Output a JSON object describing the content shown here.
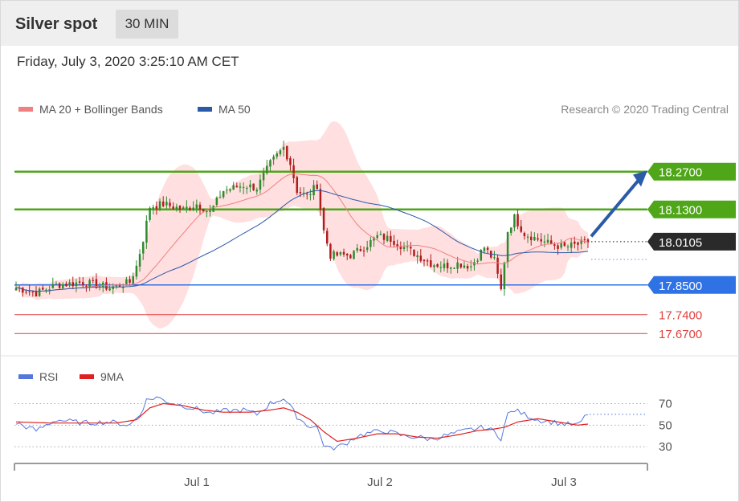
{
  "header": {
    "title": "Silver spot",
    "timeframe": "30 MIN"
  },
  "datetime": "Friday, July 3, 2020 3:25:10 AM CET",
  "legend_top": {
    "ma20": {
      "label": "MA 20 + Bollinger Bands",
      "color": "#f08080"
    },
    "ma50": {
      "label": "MA 50",
      "color": "#2b5aa8"
    }
  },
  "credit": "Research © 2020 Trading Central",
  "legend_rsi": {
    "rsi": {
      "label": "RSI",
      "color": "#5577dd"
    },
    "ma9": {
      "label": "9MA",
      "color": "#e02020"
    }
  },
  "chart_data": {
    "type": "candlestick",
    "price_range": [
      17.62,
      18.43
    ],
    "x_ticks": [
      "Jul 1",
      "Jul 2",
      "Jul 3"
    ],
    "levels": [
      {
        "value": "18.2700",
        "color": "#4ea618",
        "type": "resistance"
      },
      {
        "value": "18.1300",
        "color": "#4ea618",
        "type": "resistance"
      },
      {
        "value": "18.0105",
        "color": "#2a2a2a",
        "type": "last"
      },
      {
        "value": "17.8500",
        "color": "#2f72e6",
        "type": "pivot"
      },
      {
        "value": "17.7400",
        "color": "#e04040",
        "type": "support"
      },
      {
        "value": "17.6700",
        "color": "#e04040",
        "type": "support"
      }
    ],
    "close_keypoints": [
      [
        0,
        17.84
      ],
      [
        6,
        17.82
      ],
      [
        12,
        17.85
      ],
      [
        20,
        17.86
      ],
      [
        28,
        17.84
      ],
      [
        34,
        17.86
      ],
      [
        36,
        17.92
      ],
      [
        38,
        18.02
      ],
      [
        40,
        18.14
      ],
      [
        44,
        18.15
      ],
      [
        50,
        18.13
      ],
      [
        54,
        18.15
      ],
      [
        58,
        18.12
      ],
      [
        62,
        18.2
      ],
      [
        68,
        18.22
      ],
      [
        72,
        18.21
      ],
      [
        76,
        18.3
      ],
      [
        80,
        18.36
      ],
      [
        82,
        18.3
      ],
      [
        84,
        18.2
      ],
      [
        87,
        18.18
      ],
      [
        90,
        18.22
      ],
      [
        92,
        18.05
      ],
      [
        94,
        17.96
      ],
      [
        100,
        17.96
      ],
      [
        104,
        17.99
      ],
      [
        108,
        18.03
      ],
      [
        112,
        18.02
      ],
      [
        116,
        17.99
      ],
      [
        120,
        17.96
      ],
      [
        124,
        17.93
      ],
      [
        128,
        17.92
      ],
      [
        132,
        17.93
      ],
      [
        136,
        17.92
      ],
      [
        140,
        17.99
      ],
      [
        143,
        17.94
      ],
      [
        145,
        17.83
      ],
      [
        147,
        18.05
      ],
      [
        149,
        18.1
      ],
      [
        152,
        18.04
      ],
      [
        156,
        18.02
      ],
      [
        160,
        18.0
      ],
      [
        164,
        17.99
      ],
      [
        168,
        18.0
      ],
      [
        171,
        18.01
      ]
    ],
    "rsi": {
      "y_ticks": [
        70,
        50,
        30
      ],
      "range": [
        22,
        80
      ],
      "rsi_keypoints": [
        [
          0,
          52
        ],
        [
          6,
          45
        ],
        [
          12,
          55
        ],
        [
          20,
          52
        ],
        [
          28,
          53
        ],
        [
          34,
          50
        ],
        [
          37,
          60
        ],
        [
          39,
          73
        ],
        [
          42,
          76
        ],
        [
          45,
          72
        ],
        [
          50,
          68
        ],
        [
          54,
          65
        ],
        [
          58,
          61
        ],
        [
          62,
          63
        ],
        [
          68,
          64
        ],
        [
          72,
          60
        ],
        [
          76,
          70
        ],
        [
          80,
          75
        ],
        [
          82,
          67
        ],
        [
          84,
          58
        ],
        [
          87,
          50
        ],
        [
          90,
          48
        ],
        [
          92,
          32
        ],
        [
          94,
          28
        ],
        [
          98,
          32
        ],
        [
          102,
          40
        ],
        [
          106,
          43
        ],
        [
          110,
          45
        ],
        [
          116,
          40
        ],
        [
          120,
          39
        ],
        [
          124,
          37
        ],
        [
          128,
          40
        ],
        [
          132,
          43
        ],
        [
          136,
          46
        ],
        [
          140,
          48
        ],
        [
          143,
          44
        ],
        [
          145,
          38
        ],
        [
          147,
          60
        ],
        [
          149,
          64
        ],
        [
          152,
          60
        ],
        [
          156,
          55
        ],
        [
          160,
          53
        ],
        [
          164,
          51
        ],
        [
          168,
          50
        ],
        [
          171,
          61
        ]
      ],
      "ma9_keypoints": [
        [
          0,
          53
        ],
        [
          10,
          52
        ],
        [
          20,
          52
        ],
        [
          30,
          52
        ],
        [
          36,
          55
        ],
        [
          40,
          66
        ],
        [
          44,
          70
        ],
        [
          50,
          68
        ],
        [
          56,
          64
        ],
        [
          62,
          62
        ],
        [
          70,
          62
        ],
        [
          76,
          64
        ],
        [
          80,
          66
        ],
        [
          84,
          62
        ],
        [
          88,
          55
        ],
        [
          92,
          44
        ],
        [
          96,
          35
        ],
        [
          102,
          38
        ],
        [
          108,
          42
        ],
        [
          114,
          42
        ],
        [
          120,
          39
        ],
        [
          126,
          38
        ],
        [
          132,
          41
        ],
        [
          138,
          45
        ],
        [
          142,
          46
        ],
        [
          146,
          48
        ],
        [
          150,
          53
        ],
        [
          156,
          56
        ],
        [
          162,
          53
        ],
        [
          168,
          50
        ],
        [
          171,
          51
        ]
      ]
    }
  }
}
